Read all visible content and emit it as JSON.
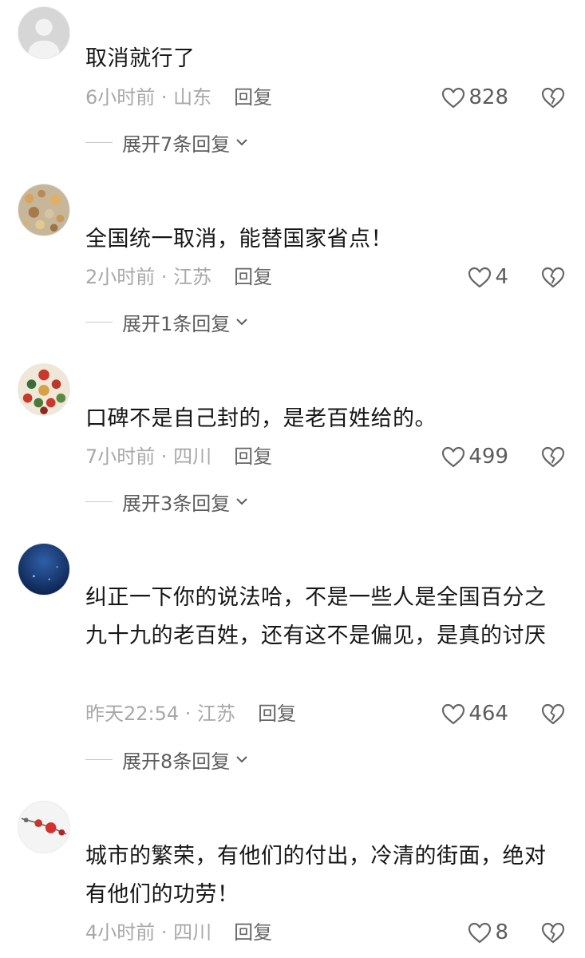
{
  "comments": [
    {
      "text": "取消就行了",
      "meta": "6小时前 · 山东",
      "reply_label": "回复",
      "likes": "828",
      "expand_label": "展开7条回复",
      "avatar": "default-gray-avatar"
    },
    {
      "text": "全国统一取消，能替国家省点！",
      "meta": "2小时前 · 江苏",
      "reply_label": "回复",
      "likes": "4",
      "expand_label": "展开1条回复",
      "avatar": "food-photo-avatar"
    },
    {
      "text": "口碑不是自己封的，是老百姓给的。",
      "meta": "7小时前 · 四川",
      "reply_label": "回复",
      "likes": "499",
      "expand_label": "展开3条回复",
      "avatar": "group-painting-avatar"
    },
    {
      "text": "纠正一下你的说法哈，不是一些人是全国百分之九十九的老百姓，还有这不是偏见，是真的讨厌",
      "meta": "昨天22:54 · 江苏",
      "reply_label": "回复",
      "likes": "464",
      "expand_label": "展开8条回复",
      "avatar": "deep-blue-ocean-avatar"
    },
    {
      "text": "城市的繁荣，有他们的付出，冷清的街面，绝对有他们的功劳！",
      "meta": "4小时前 · 四川",
      "reply_label": "回复",
      "likes": "8",
      "avatar": "red-flowers-avatar"
    }
  ],
  "colors": {
    "text": "#161616",
    "meta": "#a8a8a8",
    "action": "#5c5c5c",
    "icon": "#666666"
  },
  "icons": {
    "like": "heart-outline-icon",
    "dislike": "broken-heart-icon",
    "expand": "chevron-down-icon"
  }
}
